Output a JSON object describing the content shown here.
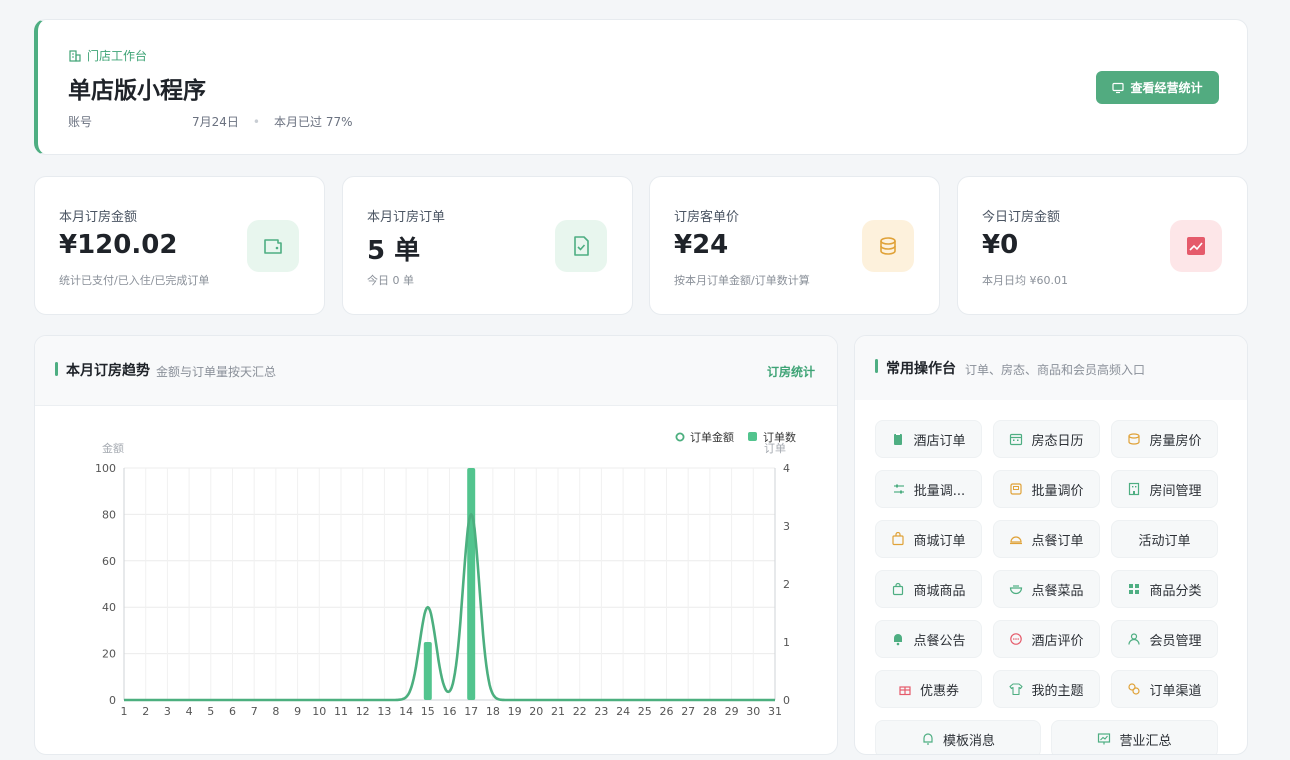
{
  "header": {
    "tag": "门店工作台",
    "title": "单店版小程序",
    "account_label": "账号",
    "date": "7月24日",
    "progress_text": "本月已过 77%",
    "month_elapsed_percent": 77,
    "stat_button": "查看经营统计"
  },
  "metrics": [
    {
      "label": "本月订房金额",
      "value": "¥120.02",
      "sub": "统计已支付/已入住/已完成订单",
      "icon": "wallet-icon",
      "color": "#4eae82",
      "bg": "#e8f6ee"
    },
    {
      "label": "本月订房订单",
      "value": "5 单",
      "sub": "今日 0 单",
      "icon": "checklist-icon",
      "color": "#4eae82",
      "bg": "#e8f6ee"
    },
    {
      "label": "订房客单价",
      "value": "¥24",
      "sub": "按本月订单金额/订单数计算",
      "icon": "coins-icon",
      "color": "#e0a238",
      "bg": "#fdf1dc"
    },
    {
      "label": "今日订房金额",
      "value": "¥0",
      "sub": "本月日均 ¥60.01",
      "icon": "trend-icon",
      "color": "#e55b6b",
      "bg": "#fde6e8"
    }
  ],
  "trend": {
    "title": "本月订房趋势",
    "subtitle": "金额与订单量按天汇总",
    "link": "订房统计"
  },
  "chart_data": {
    "type": "line",
    "x": [
      1,
      2,
      3,
      4,
      5,
      6,
      7,
      8,
      9,
      10,
      11,
      12,
      13,
      14,
      15,
      16,
      17,
      18,
      19,
      20,
      21,
      22,
      23,
      24,
      25,
      26,
      27,
      28,
      29,
      30,
      31
    ],
    "series": [
      {
        "name": "订单金额",
        "type": "line",
        "axis": "left",
        "values": [
          0,
          0,
          0,
          0,
          0,
          0,
          0,
          0,
          0,
          0,
          0,
          0,
          0,
          0,
          40,
          0,
          80,
          0,
          0,
          0,
          0,
          0,
          0,
          0,
          0,
          0,
          0,
          0,
          0,
          0,
          0
        ]
      },
      {
        "name": "订单数",
        "type": "bar",
        "axis": "right",
        "values": [
          0,
          0,
          0,
          0,
          0,
          0,
          0,
          0,
          0,
          0,
          0,
          0,
          0,
          0,
          1,
          0,
          4,
          0,
          0,
          0,
          0,
          0,
          0,
          0,
          0,
          0,
          0,
          0,
          0,
          0,
          0
        ]
      }
    ],
    "ylabel_left": "金额",
    "ylabel_right": "订单",
    "ylim_left": [
      0,
      100
    ],
    "ylim_right": [
      0,
      4
    ],
    "yticks_left": [
      0,
      20,
      40,
      60,
      80,
      100
    ],
    "yticks_right": [
      0,
      1,
      2,
      3,
      4
    ],
    "legend": "top-right",
    "grid": true,
    "colors": {
      "line": "#4caf7f",
      "bar": "#52c48e"
    }
  },
  "ops": {
    "title": "常用操作台",
    "subtitle": "订单、房态、商品和会员高频入口",
    "items": [
      {
        "label": "酒店订单",
        "icon": "clipboard-icon",
        "color": "#4eae82"
      },
      {
        "label": "房态日历",
        "icon": "calendar-icon",
        "color": "#4eae82"
      },
      {
        "label": "房量房价",
        "icon": "coins-icon",
        "color": "#e0a238"
      },
      {
        "label": "批量调...",
        "icon": "sliders-icon",
        "color": "#4eae82"
      },
      {
        "label": "批量调价",
        "icon": "price-tag-icon",
        "color": "#e0a238"
      },
      {
        "label": "房间管理",
        "icon": "building-icon",
        "color": "#4eae82"
      },
      {
        "label": "商城订单",
        "icon": "shopping-bag-icon",
        "color": "#e0a238"
      },
      {
        "label": "点餐订单",
        "icon": "food-cover-icon",
        "color": "#e0a238"
      },
      {
        "label": "活动订单",
        "icon": "",
        "color": "#4eae82"
      },
      {
        "label": "商城商品",
        "icon": "bag-icon",
        "color": "#4eae82"
      },
      {
        "label": "点餐菜品",
        "icon": "bowl-icon",
        "color": "#4eae82"
      },
      {
        "label": "商品分类",
        "icon": "grid-icon",
        "color": "#4eae82"
      },
      {
        "label": "点餐公告",
        "icon": "bell-icon",
        "color": "#4eae82"
      },
      {
        "label": "酒店评价",
        "icon": "chat-icon",
        "color": "#e55b6b"
      },
      {
        "label": "会员管理",
        "icon": "user-icon",
        "color": "#4eae82"
      },
      {
        "label": "优惠券",
        "icon": "gift-icon",
        "color": "#e55b6b"
      },
      {
        "label": "我的主题",
        "icon": "shirt-icon",
        "color": "#4eae82"
      },
      {
        "label": "订单渠道",
        "icon": "channel-icon",
        "color": "#e0a238"
      },
      {
        "label": "模板消息",
        "icon": "bell-outline-icon",
        "color": "#4eae82"
      },
      {
        "label": "营业汇总",
        "icon": "chart-board-icon",
        "color": "#4eae82"
      }
    ]
  }
}
